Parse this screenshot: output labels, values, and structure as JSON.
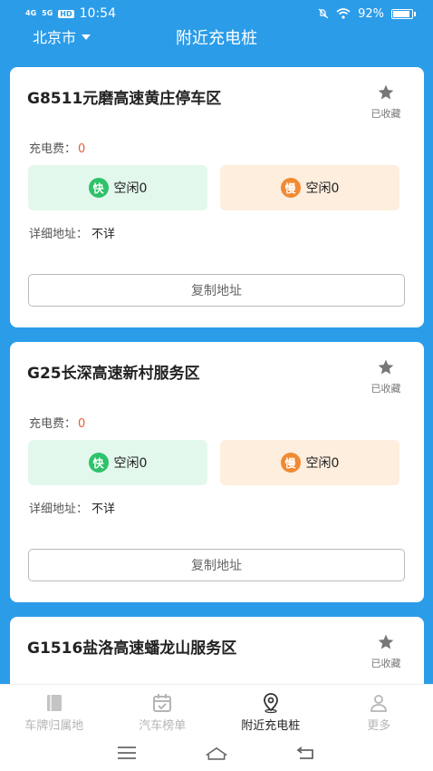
{
  "status_bar": {
    "time": "10:54",
    "signal_1": "4G",
    "signal_2": "5G",
    "hd": "HD",
    "battery": "92%"
  },
  "header": {
    "city": "北京市",
    "title": "附近充电桩"
  },
  "stations": [
    {
      "name": "G8511元磨高速黄庄停车区",
      "fav_label": "已收藏",
      "fee_label": "充电费：",
      "fee_value": "0",
      "fast_badge": "快",
      "fast_text": "空闲0",
      "slow_badge": "慢",
      "slow_text": "空闲0",
      "addr_label": "详细地址：",
      "addr_value": "不详",
      "copy_label": "复制地址"
    },
    {
      "name": "G25长深高速新村服务区",
      "fav_label": "已收藏",
      "fee_label": "充电费：",
      "fee_value": "0",
      "fast_badge": "快",
      "fast_text": "空闲0",
      "slow_badge": "慢",
      "slow_text": "空闲0",
      "addr_label": "详细地址：",
      "addr_value": "不详",
      "copy_label": "复制地址"
    },
    {
      "name": "G1516盐洛高速蟠龙山服务区",
      "fav_label": "已收藏"
    }
  ],
  "bottom_nav": [
    {
      "label": "车牌归属地",
      "icon": "book-icon",
      "active": false
    },
    {
      "label": "汽车榜单",
      "icon": "calendar-check-icon",
      "active": false
    },
    {
      "label": "附近充电桩",
      "icon": "location-pin-icon",
      "active": true
    },
    {
      "label": "更多",
      "icon": "user-icon",
      "active": false
    }
  ],
  "colors": {
    "background": "#2b9ce8",
    "fast": "#2ec26a",
    "slow": "#f08a33",
    "fee_value": "#e0603a"
  }
}
